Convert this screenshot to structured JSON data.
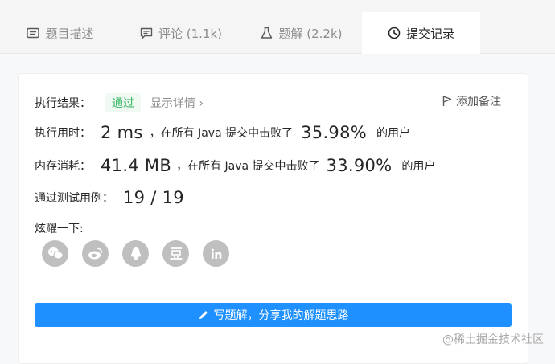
{
  "tabs": [
    {
      "label": "题目描述",
      "icon": "description-icon"
    },
    {
      "label": "评论 (1.1k)",
      "icon": "comment-icon"
    },
    {
      "label": "题解 (2.2k)",
      "icon": "flask-icon"
    },
    {
      "label": "提交记录",
      "icon": "clock-icon"
    }
  ],
  "active_tab": "提交记录",
  "result": {
    "label": "执行结果：",
    "status": "通过",
    "detail_link": "显示详情 ›",
    "add_note": "添加备注"
  },
  "runtime": {
    "label": "执行用时：",
    "value": "2 ms",
    "prefix": "，在所有 Java 提交中击败了",
    "percent": "35.98%",
    "suffix": "的用户"
  },
  "memory": {
    "label": "内存消耗：",
    "value": "41.4 MB",
    "prefix": "，在所有 Java 提交中击败了",
    "percent": "33.90%",
    "suffix": "的用户"
  },
  "tests": {
    "label": "通过测试用例：",
    "value": "19 / 19"
  },
  "share": {
    "label": "炫耀一下:",
    "icons": [
      "wechat-icon",
      "weibo-icon",
      "qq-icon",
      "douban-icon",
      "linkedin-icon"
    ]
  },
  "cta_label": "写题解，分享我的解题思路",
  "watermark": "@稀土掘金技术社区",
  "colors": {
    "accent_blue": "#1e90ff",
    "pass_green": "#2db55d",
    "share_gray": "#bfbfbf"
  }
}
